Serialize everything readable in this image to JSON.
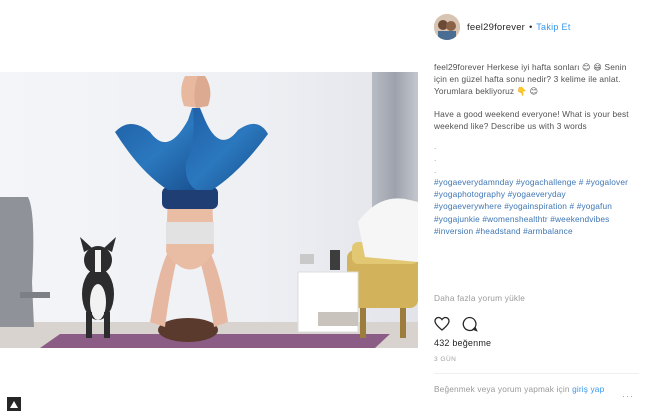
{
  "post": {
    "username": "feel29forever",
    "separator": "•",
    "follow_label": "Takip Et",
    "caption_tr": "feel29forever Herkese iyi hafta sonları 😊 😄 Senin için en güzel hafta sonu nedir? 3 kelime ile anlat. Yorumlara bekliyoruz 👇 😊",
    "caption_en": "Have a good weekend everyone! What is your best weekend like? Describe us with 3 words",
    "dots": [
      ".",
      ".",
      "."
    ],
    "hashtags": "#yogaeverydamnday #yogachallenge # #yogalover #yogaphotography #yogaeveryday #yogaeverywhere #yogainspiration # #yogafun #yogajunkie #womenshealthtr #weekendvibes #inversion #headstand #armbalance",
    "more_comments_label": "Daha fazla yorum yükle",
    "likes_label": "432 beğenme",
    "time_label": "3 GÜN",
    "login_text": "Beğenmek veya yorum yapmak için",
    "login_link": "giriş yap",
    "options_label": "···"
  },
  "icons": {
    "like": "heart-outline-icon",
    "comment": "comment-bubble-icon",
    "corner": "save-icon"
  },
  "colors": {
    "link": "#3897f0",
    "hashtag": "#3e76b5",
    "muted": "#9a9a9a",
    "text": "#262626"
  }
}
